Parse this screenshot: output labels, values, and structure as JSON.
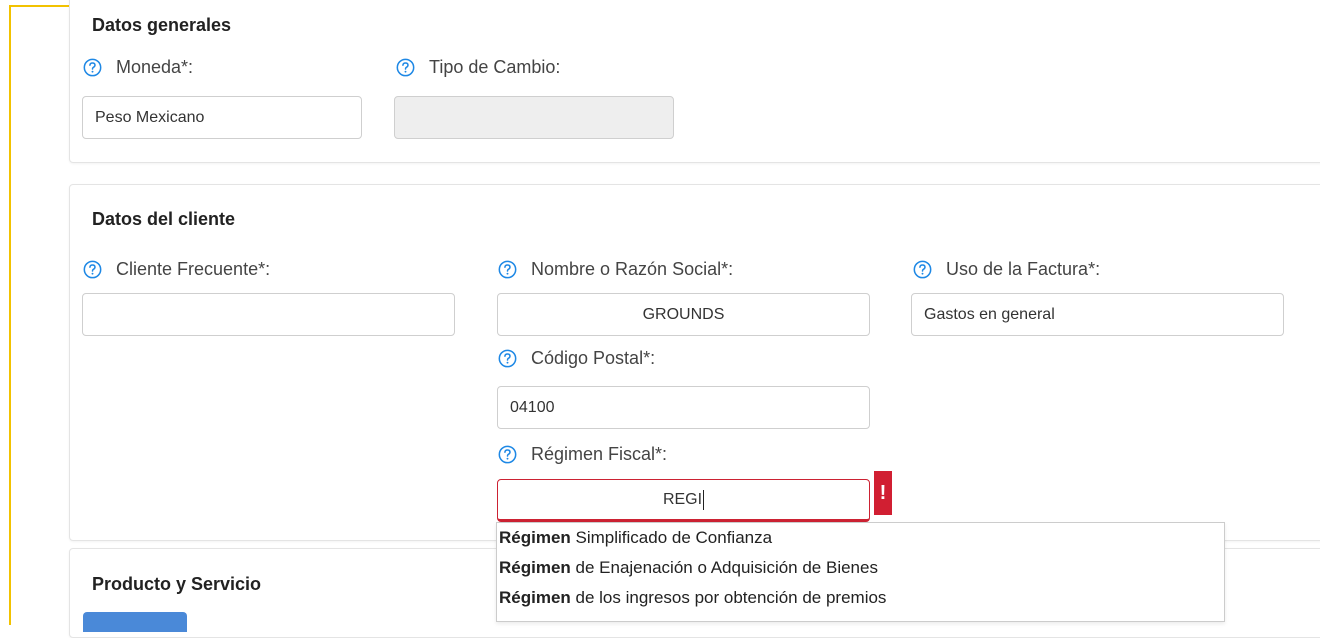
{
  "general": {
    "title": "Datos generales",
    "moneda_label": "Moneda*:",
    "moneda_value": "Peso Mexicano",
    "tipo_cambio_label": "Tipo de Cambio:",
    "tipo_cambio_value": ""
  },
  "cliente": {
    "title": "Datos del cliente",
    "frecuente_label": "Cliente Frecuente*:",
    "frecuente_value": "",
    "nombre_label": "Nombre o Razón Social*:",
    "nombre_value": "GROUNDS",
    "uso_label": "Uso de la Factura*:",
    "uso_value": "Gastos en general",
    "cp_label": "Código Postal*:",
    "cp_value": "04100",
    "regimen_label": "Régimen Fiscal*:",
    "regimen_value": "REGI",
    "error_mark": "!"
  },
  "autocomplete": {
    "items": [
      {
        "match": "Régimen",
        "rest": " Simplificado de Confianza"
      },
      {
        "match": "Régimen",
        "rest": " de Enajenación o Adquisición de Bienes"
      },
      {
        "match": "Régimen",
        "rest": " de los ingresos por obtención de premios"
      }
    ]
  },
  "producto": {
    "title": "Producto y Servicio"
  },
  "icons": {
    "help": "question-circle-icon",
    "accent": "#1e88e5",
    "error": "#d11f32",
    "frame": "#f2c200"
  }
}
